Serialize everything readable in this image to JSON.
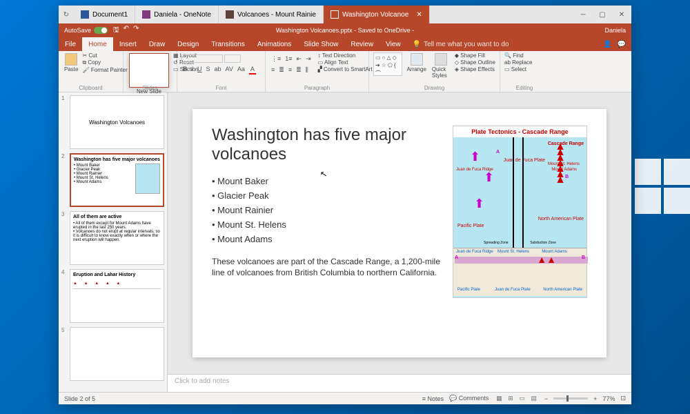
{
  "tabs": [
    {
      "label": "Document1",
      "kind": "word"
    },
    {
      "label": "Daniela - OneNote",
      "kind": "on"
    },
    {
      "label": "Volcanoes - Mount Rainie",
      "kind": "np"
    },
    {
      "label": "Washington Volcanoe",
      "kind": "pp",
      "active": true
    }
  ],
  "titlebar": {
    "autosave": "AutoSave",
    "filename": "Washington Volcanoes.pptx - Saved to OneDrive -",
    "user": "Daniela"
  },
  "menu": {
    "items": [
      "File",
      "Home",
      "Insert",
      "Draw",
      "Design",
      "Transitions",
      "Animations",
      "Slide Show",
      "Review",
      "View"
    ],
    "active": "Home",
    "tell": "Tell me what you want to do"
  },
  "ribbon": {
    "clipboard": {
      "label": "Clipboard",
      "paste": "Paste",
      "cut": "Cut",
      "copy": "Copy",
      "fp": "Format Painter"
    },
    "slides": {
      "label": "Slides",
      "new": "New Slide",
      "layout": "Layout",
      "reset": "Reset",
      "section": "Section"
    },
    "font": {
      "label": "Font"
    },
    "paragraph": {
      "label": "Paragraph",
      "td": "Text Direction",
      "at": "Align Text",
      "cs": "Convert to SmartArt"
    },
    "drawing": {
      "label": "Drawing",
      "arrange": "Arrange",
      "qs": "Quick Styles",
      "sf": "Shape Fill",
      "so": "Shape Outline",
      "se": "Shape Effects"
    },
    "editing": {
      "label": "Editing",
      "find": "Find",
      "replace": "Replace",
      "select": "Select"
    }
  },
  "thumbs": [
    {
      "n": "1",
      "title": "Washington Volcanoes"
    },
    {
      "n": "2",
      "title": "Washington has five major volcanoes",
      "sel": true
    },
    {
      "n": "3",
      "title": "All of them are active"
    },
    {
      "n": "4",
      "title": "Eruption and Lahar History"
    },
    {
      "n": "5",
      "title": ""
    }
  ],
  "slide": {
    "title": "Washington has five major volcanoes",
    "bullets": [
      "Mount Baker",
      "Glacier Peak",
      "Mount Rainier",
      "Mount St. Helens",
      "Mount Adams"
    ],
    "para": "These volcanoes are part of the Cascade Range, a 1,200-mile line of volcanoes from British Columbia to northern California.",
    "img": {
      "title": "Plate Tectonics - Cascade Range",
      "labels": {
        "cr": "Cascade Range",
        "jdf": "Juan de Fuca Plate",
        "jdfr": "Juan de Fuca Ridge",
        "pp": "Pacific Plate",
        "nap": "North American Plate",
        "msh": "Mount St. Helens",
        "ma": "Mount Adams",
        "sz": "Spreading Zone",
        "sub": "Subduction Zone"
      }
    }
  },
  "notes": {
    "placeholder": "Click to add notes"
  },
  "status": {
    "slide": "Slide 2 of 5",
    "notes": "Notes",
    "comments": "Comments",
    "zoom": "77%"
  }
}
